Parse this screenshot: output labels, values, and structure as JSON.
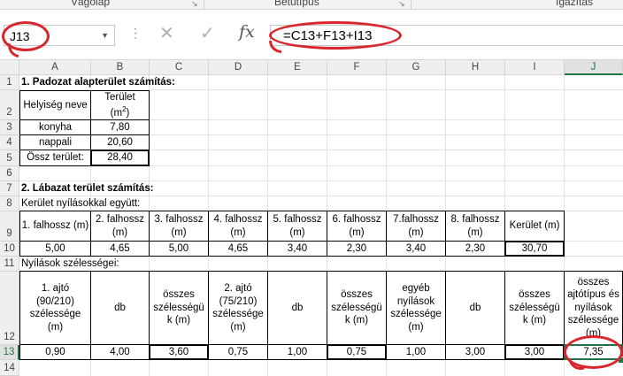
{
  "ribbon": {
    "groups": [
      "Vágólap",
      "Betűtípus",
      "Igazítás"
    ]
  },
  "formula_bar": {
    "name_box": "J13",
    "formula": "=C13+F13+I13",
    "cancel_icon": "x-icon",
    "enter_icon": "check-icon",
    "fx_label": "fx"
  },
  "columns": [
    "A",
    "B",
    "C",
    "D",
    "E",
    "F",
    "G",
    "H",
    "I",
    "J"
  ],
  "rows": [
    "1",
    "2",
    "3",
    "4",
    "5",
    "6",
    "7",
    "8",
    "9",
    "10",
    "11",
    "12",
    "13",
    "14"
  ],
  "cells": {
    "A1": "1. Padozat alapterület számítás:",
    "A2": "Helyiség neve",
    "B2_a": "Terület",
    "B2_b": "(m",
    "B2_sup": "2",
    "B2_c": ")",
    "A3": "konyha",
    "B3": "7,80",
    "A4": "nappali",
    "B4": "20,60",
    "A5": "Össz terület:",
    "B5": "28,40",
    "A7": "2. Lábazat terület számítás:",
    "A8": "Kerület nyílásokkal együtt:",
    "A9": "1. falhossz (m)",
    "B9": "2. falhossz (m)",
    "C9": "3. falhossz (m)",
    "D9": "4. falhossz (m)",
    "E9": "5. falhossz (m)",
    "F9": "6. falhossz (m)",
    "G9": "7.falhossz (m)",
    "H9": "8. falhossz (m)",
    "I9": "Kerület (m)",
    "A10": "5,00",
    "B10": "4,65",
    "C10": "5,00",
    "D10": "4,65",
    "E10": "3,40",
    "F10": "2,30",
    "G10": "3,40",
    "H10": "2,30",
    "I10": "30,70",
    "A11": "Nyílások szélességei:",
    "A12": "1. ajtó (90/210) szélessége (m)",
    "B12": "db",
    "C12": "összes szélességü k (m)",
    "D12": "2. ajtó (75/210) szélessége (m)",
    "E12": "db",
    "F12": "összes szélességü k (m)",
    "G12": "egyéb nyílások szélessége (m)",
    "H12": "db",
    "I12": "összes szélességü k (m)",
    "J12": "összes ajtótípus és nyílások szélessége (m)",
    "A13": "0,90",
    "B13": "4,00",
    "C13": "3,60",
    "D13": "0,75",
    "E13": "1,00",
    "F13": "0,75",
    "G13": "1,00",
    "H13": "3,00",
    "I13": "3,00",
    "J13": "7,35"
  },
  "colors": {
    "selection": "#217346",
    "annotation": "#d9252b"
  }
}
